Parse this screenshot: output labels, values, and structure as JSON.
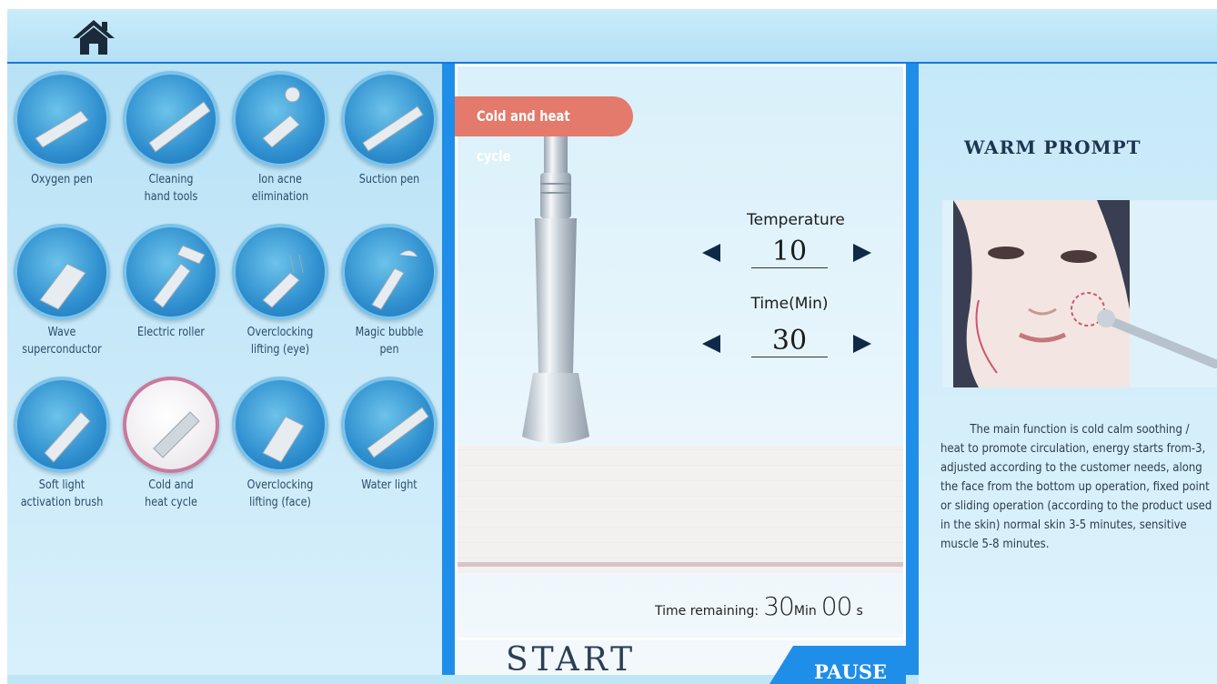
{
  "tools": [
    {
      "label": "Oxygen pen"
    },
    {
      "label": "Cleaning\nhand tools"
    },
    {
      "label": "Ion acne\nelimination"
    },
    {
      "label": "Suction pen"
    },
    {
      "label": "Wave\nsuperconductor"
    },
    {
      "label": "Electric roller"
    },
    {
      "label": "Overclocking\nlifting (eye)"
    },
    {
      "label": "Magic bubble\npen"
    },
    {
      "label": "Soft light\nactivation brush"
    },
    {
      "label": "Cold and\nheat cycle"
    },
    {
      "label": "Overclocking\nlifting (face)"
    },
    {
      "label": "Water light"
    }
  ],
  "active_tool_index": 9,
  "center": {
    "mode_tag": "Cold and heat cycle",
    "temperature_label": "Temperature",
    "temperature_value": "10",
    "time_label": "Time(Min)",
    "time_value": "30",
    "remaining_label": "Time remaining:",
    "remaining_min": "30",
    "remaining_min_unit": "Min",
    "remaining_sec": "00",
    "remaining_sec_unit": "s",
    "start_label": "START",
    "pause_label": "PAUSE"
  },
  "right": {
    "title": "WARM PROMPT",
    "description": "The main function is cold calm soothing / heat to promote circulation, energy starts from-3, adjusted according to the customer needs, along the face from the bottom up operation, fixed point or sliding operation (according to the product used in the skin) normal skin 3-5 minutes, sensitive muscle 5-8 minutes."
  },
  "colors": {
    "accent_blue": "#1479e0",
    "tag_coral": "#e37a6b",
    "active_ring": "#c87a9d"
  }
}
